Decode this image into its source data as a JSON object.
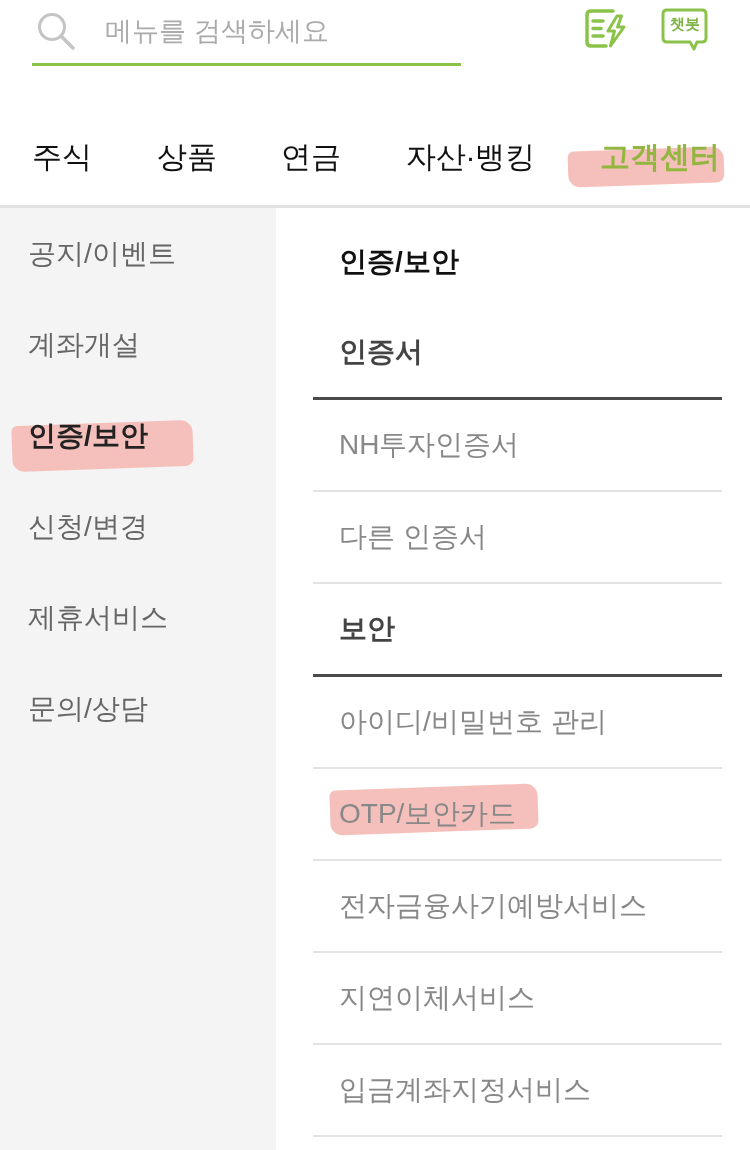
{
  "search": {
    "placeholder": "메뉴를 검색하세요"
  },
  "chatbot_button": {
    "label": "챗봇"
  },
  "tabs": [
    {
      "label": "주식",
      "selected": false,
      "highlighted": false
    },
    {
      "label": "상품",
      "selected": false,
      "highlighted": false
    },
    {
      "label": "연금",
      "selected": false,
      "highlighted": false
    },
    {
      "label": "자산·뱅킹",
      "selected": false,
      "highlighted": false
    },
    {
      "label": "고객센터",
      "selected": true,
      "highlighted": true
    }
  ],
  "sidebar": {
    "items": [
      {
        "label": "공지/이벤트",
        "selected": false,
        "highlighted": false
      },
      {
        "label": "계좌개설",
        "selected": false,
        "highlighted": false
      },
      {
        "label": "인증/보안",
        "selected": true,
        "highlighted": true
      },
      {
        "label": "신청/변경",
        "selected": false,
        "highlighted": false
      },
      {
        "label": "제휴서비스",
        "selected": false,
        "highlighted": false
      },
      {
        "label": "문의/상담",
        "selected": false,
        "highlighted": false
      }
    ]
  },
  "content": {
    "title": "인증/보안",
    "sections": [
      {
        "heading": "인증서",
        "items": [
          {
            "label": "NH투자인증서",
            "highlighted": false
          },
          {
            "label": "다른 인증서",
            "highlighted": false
          }
        ]
      },
      {
        "heading": "보안",
        "items": [
          {
            "label": "아이디/비밀번호 관리",
            "highlighted": false
          },
          {
            "label": "OTP/보안카드",
            "highlighted": true
          },
          {
            "label": "전자금융사기예방서비스",
            "highlighted": false
          },
          {
            "label": "지연이체서비스",
            "highlighted": false
          },
          {
            "label": "입금계좌지정서비스",
            "highlighted": false
          }
        ]
      }
    ]
  }
}
